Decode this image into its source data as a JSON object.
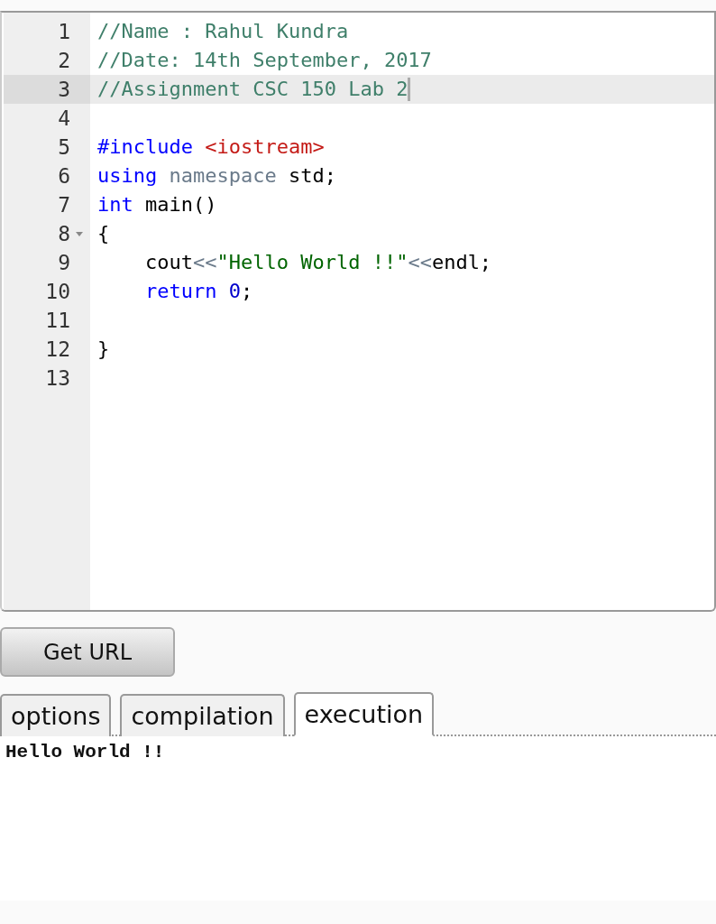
{
  "editor": {
    "lines": [
      {
        "number": "1",
        "active": false,
        "foldable": false,
        "tokens": [
          {
            "kind": "comment",
            "text": "//Name : Rahul Kundra"
          }
        ]
      },
      {
        "number": "2",
        "active": false,
        "foldable": false,
        "tokens": [
          {
            "kind": "comment",
            "text": "//Date: 14th September, 2017"
          }
        ]
      },
      {
        "number": "3",
        "active": true,
        "foldable": false,
        "tokens": [
          {
            "kind": "comment",
            "text": "//Assignment CSC 150 Lab 2"
          }
        ]
      },
      {
        "number": "4",
        "active": false,
        "foldable": false
      },
      {
        "number": "5",
        "active": false,
        "foldable": false,
        "tokens": [
          {
            "kind": "keyword",
            "text": "#include "
          },
          {
            "kind": "include",
            "text": "<iostream>"
          }
        ]
      },
      {
        "number": "6",
        "active": false,
        "foldable": false,
        "tokens": [
          {
            "kind": "keyword",
            "text": "using "
          },
          {
            "kind": "namespace",
            "text": "namespace "
          },
          {
            "kind": "plain",
            "text": "std;"
          }
        ]
      },
      {
        "number": "7",
        "active": false,
        "foldable": false,
        "tokens": [
          {
            "kind": "keyword",
            "text": "int "
          },
          {
            "kind": "plain",
            "text": "main()"
          }
        ]
      },
      {
        "number": "8",
        "active": false,
        "foldable": true,
        "tokens": [
          {
            "kind": "plain",
            "text": "{"
          }
        ]
      },
      {
        "number": "9",
        "active": false,
        "foldable": false,
        "tokens": [
          {
            "kind": "plain",
            "text": "    cout"
          },
          {
            "kind": "operator",
            "text": "<<"
          },
          {
            "kind": "string",
            "text": "\"Hello World !!\""
          },
          {
            "kind": "operator",
            "text": "<<"
          },
          {
            "kind": "plain",
            "text": "endl;"
          }
        ]
      },
      {
        "number": "10",
        "active": false,
        "foldable": false,
        "tokens": [
          {
            "kind": "keyword",
            "text": "    return "
          },
          {
            "kind": "number",
            "text": "0"
          },
          {
            "kind": "plain",
            "text": ";"
          }
        ]
      },
      {
        "number": "11",
        "active": false,
        "foldable": false
      },
      {
        "number": "12",
        "active": false,
        "foldable": false,
        "tokens": [
          {
            "kind": "plain",
            "text": "}"
          }
        ]
      },
      {
        "number": "13",
        "active": false,
        "foldable": false
      }
    ]
  },
  "buttons": [
    {
      "label": "Get URL"
    }
  ],
  "tabs": [
    {
      "label": "options",
      "selected": false
    },
    {
      "label": "compilation",
      "selected": false
    },
    {
      "label": "execution",
      "selected": true
    }
  ],
  "output": {
    "text": "Hello World !!"
  }
}
